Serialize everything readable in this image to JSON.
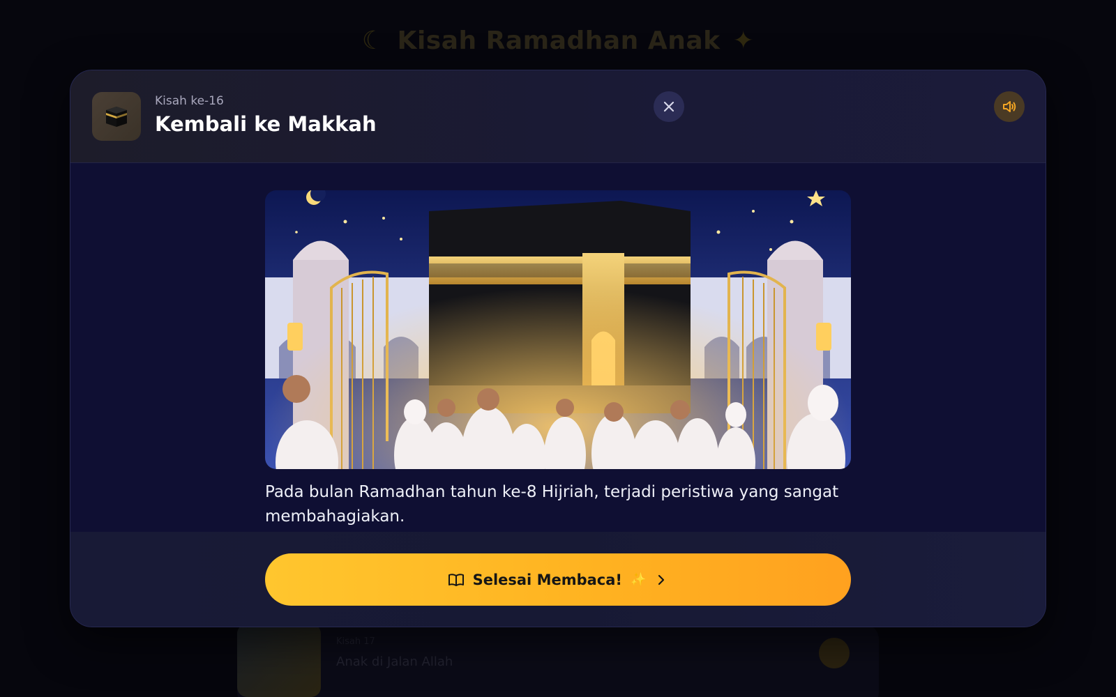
{
  "background": {
    "app_title": "Kisah Ramadhan Anak",
    "card_episode": "Kisah 17",
    "card_title": "Anak di Jalan Allah"
  },
  "modal": {
    "episode_label": "Kisah ke-16",
    "title": "Kembali ke Makkah",
    "story_text": "Pada bulan Ramadhan tahun ke-8 Hijriah, terjadi peristiwa yang sangat membahagiakan.",
    "finish_button": "Selesai Membaca!",
    "icons": {
      "story": "kaaba-icon",
      "close": "close-icon",
      "sound": "speaker-icon",
      "book": "book-open-icon",
      "sparkle": "sparkle-icon",
      "chevron": "chevron-right-icon"
    }
  },
  "colors": {
    "modal_bg": "#0f0f33",
    "accent_yellow": "#ffc62e",
    "accent_orange": "#ffa11f",
    "sound_icon": "#f5a623"
  }
}
